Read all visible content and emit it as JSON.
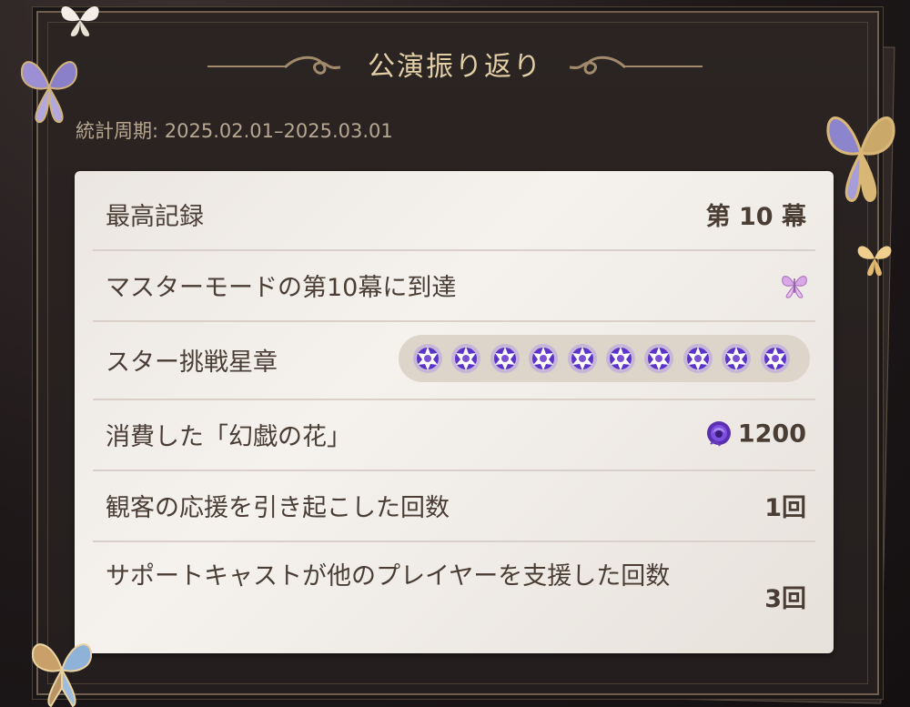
{
  "header": {
    "title": "公演振り返り"
  },
  "period": {
    "label": "統計周期:",
    "range": "2025.02.01–2025.03.01"
  },
  "rows": [
    {
      "label": "最高記録",
      "value": "第 10 幕"
    },
    {
      "label": "マスターモードの第10幕に到達",
      "icon": "butterfly-badge-icon"
    },
    {
      "label": "スター挑戦星章",
      "star_count": 10,
      "icon": "star-medal-icon"
    },
    {
      "label": "消費した「幻戯の花」",
      "value": "1200",
      "icon": "purple-rose-icon"
    },
    {
      "label": "観客の応援を引き起こした回数",
      "value": "1回"
    },
    {
      "label": "サポートキャストが他のプレイヤーを支援した回数",
      "value": "3回"
    }
  ],
  "colors": {
    "accent": "#e3cfa6",
    "panel": "#241e1e",
    "card": "#f1ede8",
    "text": "#4a3d34",
    "star": "#7b4fd6"
  }
}
